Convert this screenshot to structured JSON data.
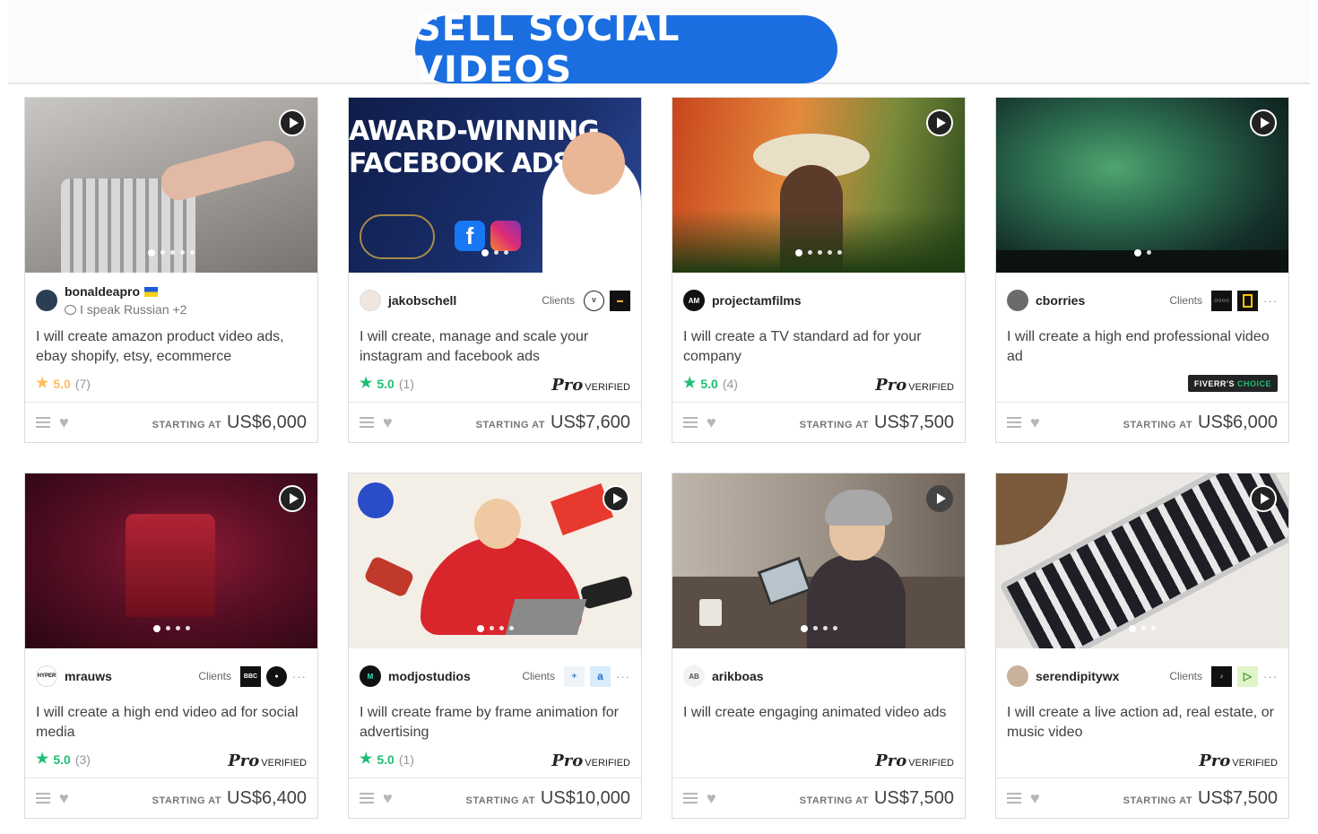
{
  "page_title": "SELL SOCIAL VIDEOS",
  "common": {
    "starting_at": "STARTING AT",
    "clients_label": "Clients",
    "pro_label": "Pro",
    "verified_label": "VERIFIED",
    "choice_label_a": "FIVERR'S",
    "choice_label_b": "CHOICE"
  },
  "colors": {
    "accent": "#1a6ee0",
    "star": "#1dbf73",
    "star_orange": "#ffbe5b"
  },
  "gigs": [
    {
      "seller": "bonaldeapro",
      "seller_sub": "I speak Russian +2",
      "title": "I will create amazon product video ads, ebay shopify, etsy, ecommerce",
      "rating": "5.0",
      "rating_count": "(7)",
      "badge": "none",
      "price": "US$6,000",
      "avatar_letters": "",
      "star_color": "orange"
    },
    {
      "seller": "jakobschell",
      "title": "I will create, manage and scale your instagram and facebook ads",
      "rating": "5.0",
      "rating_count": "(1)",
      "badge": "pro",
      "price": "US$7,600",
      "thumb_text_1": "AWARD-WINNING",
      "thumb_text_2": "FACEBOOK ADS"
    },
    {
      "seller": "projectamfilms",
      "title": "I will create a TV standard ad for your company",
      "rating": "5.0",
      "rating_count": "(4)",
      "badge": "pro",
      "price": "US$7,500"
    },
    {
      "seller": "cborries",
      "title": "I will create a high end professional video ad",
      "badge": "choice",
      "price": "US$6,000"
    },
    {
      "seller": "mrauws",
      "title": "I will create a high end video ad for social media",
      "rating": "5.0",
      "rating_count": "(3)",
      "badge": "pro",
      "price": "US$6,400"
    },
    {
      "seller": "modjostudios",
      "title": "I will create frame by frame animation for advertising",
      "rating": "5.0",
      "rating_count": "(1)",
      "badge": "pro",
      "price": "US$10,000"
    },
    {
      "seller": "arikboas",
      "title": "I will create engaging animated video ads",
      "badge": "pro",
      "price": "US$7,500"
    },
    {
      "seller": "serendipitywx",
      "title": "I will create a live action ad, real estate, or music video",
      "badge": "pro",
      "price": "US$7,500"
    }
  ]
}
